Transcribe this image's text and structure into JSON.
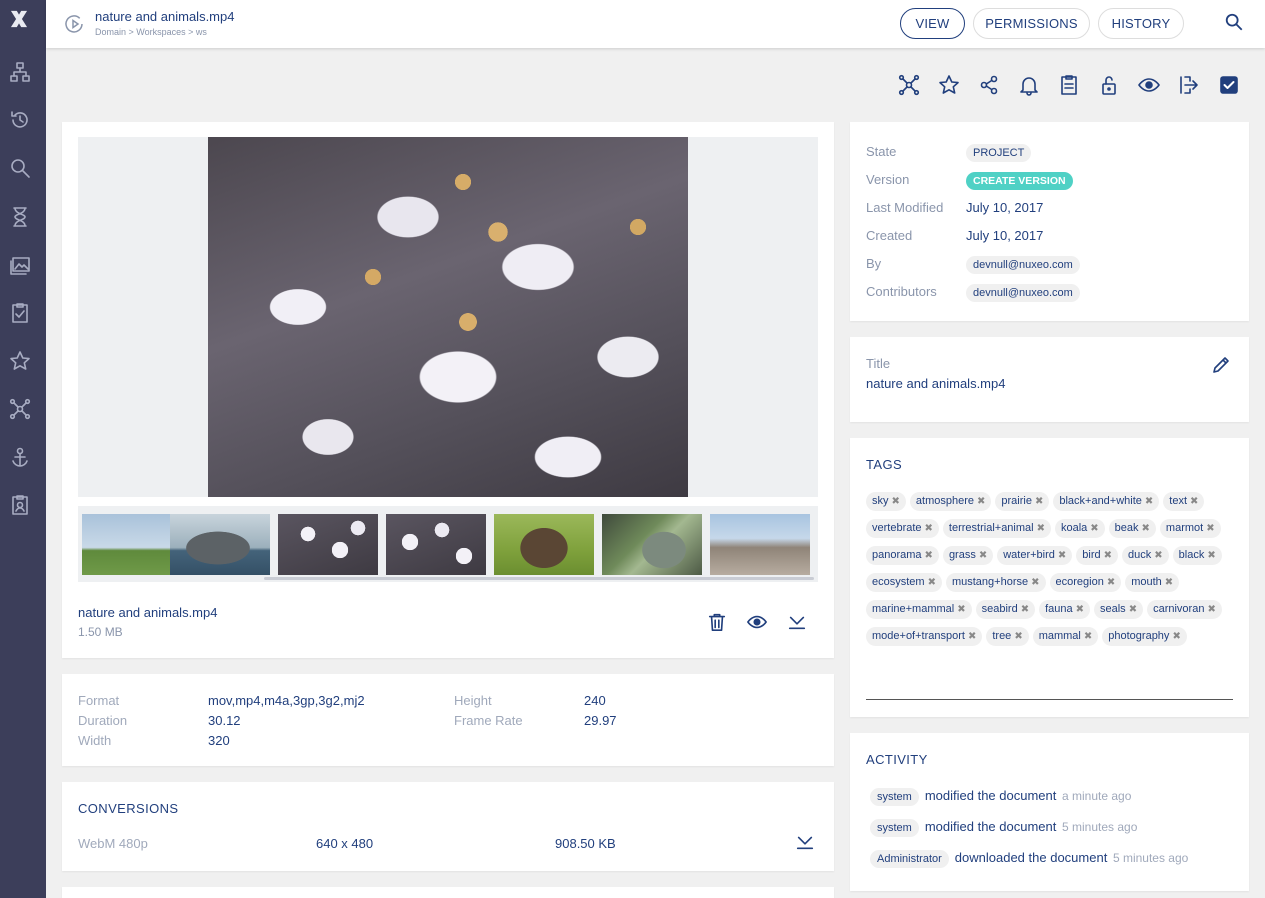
{
  "header": {
    "title": "nature and animals.mp4",
    "breadcrumb": "Domain > Workspaces > ws",
    "tabs": [
      {
        "label": "VIEW",
        "active": true
      },
      {
        "label": "PERMISSIONS",
        "active": false
      },
      {
        "label": "HISTORY",
        "active": false
      }
    ]
  },
  "sidebar": {
    "items": [
      "browse-icon",
      "history-icon",
      "search-icon",
      "hourglass-icon",
      "gallery-icon",
      "tasks-icon",
      "favorites-icon",
      "collections-icon",
      "admin-icon",
      "profile-icon"
    ]
  },
  "toolbar": {
    "actions": [
      "collections-icon",
      "star-icon",
      "share-icon",
      "bell-icon",
      "clipboard-icon",
      "lock-open-icon",
      "eye-icon",
      "export-icon",
      "checkbox-icon"
    ]
  },
  "file": {
    "name": "nature and animals.mp4",
    "size": "1.50 MB"
  },
  "video_info": {
    "format_label": "Format",
    "format": "mov,mp4,m4a,3gp,3g2,mj2",
    "duration_label": "Duration",
    "duration": "30.12",
    "width_label": "Width",
    "width": "320",
    "height_label": "Height",
    "height": "240",
    "frame_rate_label": "Frame Rate",
    "frame_rate": "29.97"
  },
  "conversions": {
    "title": "CONVERSIONS",
    "rows": [
      {
        "name": "WebM 480p",
        "dimensions": "640 x 480",
        "size": "908.50 KB"
      }
    ]
  },
  "metadata": {
    "state_label": "State",
    "state": "PROJECT",
    "version_label": "Version",
    "version_action": "CREATE VERSION",
    "last_modified_label": "Last Modified",
    "last_modified": "July 10, 2017",
    "created_label": "Created",
    "created": "July 10, 2017",
    "by_label": "By",
    "by": "devnull@nuxeo.com",
    "contributors_label": "Contributors",
    "contributors": "devnull@nuxeo.com"
  },
  "title_card": {
    "label": "Title",
    "value": "nature and animals.mp4"
  },
  "tags": {
    "title": "TAGS",
    "items": [
      "sky",
      "atmosphere",
      "prairie",
      "black+and+white",
      "text",
      "vertebrate",
      "terrestrial+animal",
      "koala",
      "beak",
      "marmot",
      "panorama",
      "grass",
      "water+bird",
      "bird",
      "duck",
      "black",
      "ecosystem",
      "mustang+horse",
      "ecoregion",
      "mouth",
      "marine+mammal",
      "seabird",
      "fauna",
      "seals",
      "carnivoran",
      "mode+of+transport",
      "tree",
      "mammal",
      "photography"
    ]
  },
  "activity": {
    "title": "ACTIVITY",
    "items": [
      {
        "user": "system",
        "action": "modified the document",
        "time": "a minute ago"
      },
      {
        "user": "system",
        "action": "modified the document",
        "time": "5 minutes ago"
      },
      {
        "user": "Administrator",
        "action": "downloaded the document",
        "time": "5 minutes ago"
      }
    ]
  },
  "colors": {
    "sidebar": "#3c3e5a",
    "text": "#213f7d",
    "accent": "#4fd1c5"
  }
}
